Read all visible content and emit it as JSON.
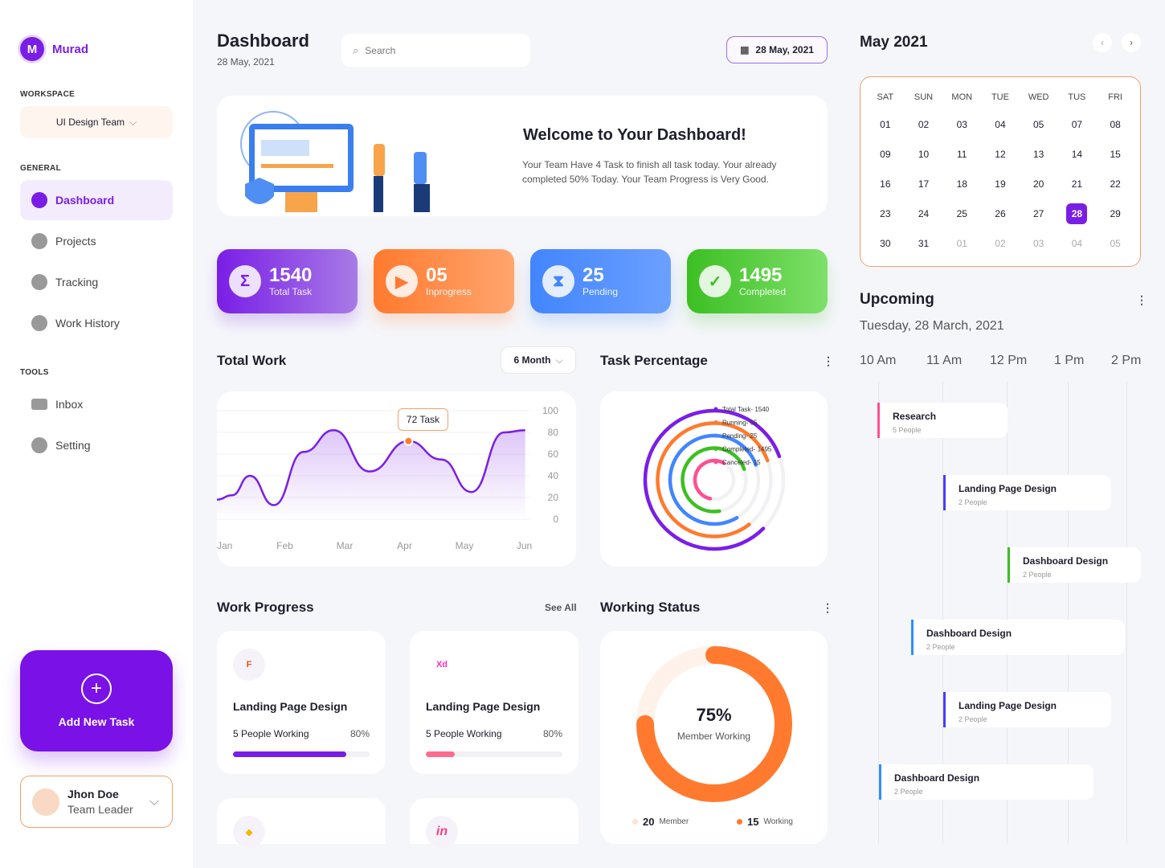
{
  "sidebar": {
    "brand": "Murad",
    "brand_initial": "M",
    "workspace_label": "WORKSPACE",
    "workspace_value": "UI Design Team",
    "general_label": "GENERAL",
    "tools_label": "TOOLS",
    "general_items": [
      {
        "label": "Dashboard",
        "icon": "dashboard-icon",
        "active": true
      },
      {
        "label": "Projects",
        "icon": "briefcase-icon"
      },
      {
        "label": "Tracking",
        "icon": "tracking-icon"
      },
      {
        "label": "Work History",
        "icon": "history-icon"
      }
    ],
    "tools_items": [
      {
        "label": "Inbox",
        "icon": "mail-icon"
      },
      {
        "label": "Setting",
        "icon": "gear-icon"
      }
    ],
    "add_task": "Add New Task",
    "user_name": "Jhon Doe",
    "user_role": "Team Leader"
  },
  "header": {
    "title": "Dashboard",
    "date": "28 May, 2021",
    "search_placeholder": "Search",
    "date_button": "28 May, 2021"
  },
  "welcome": {
    "title": "Welcome to Your Dashboard!",
    "text": "Your Team Have 4 Task to finish all task today. Your already completed 50% Today. Your Team Progress is Very Good."
  },
  "stats": [
    {
      "value": "1540",
      "label": "Total Task",
      "color": "#7a1ee6"
    },
    {
      "value": "05",
      "label": "Inprogress",
      "color": "#ff7a2e"
    },
    {
      "value": "25",
      "label": "Pending",
      "color": "#4285ff"
    },
    {
      "value": "1495",
      "label": "Completed",
      "color": "#3cbf23"
    }
  ],
  "total_work": {
    "title": "Total Work",
    "filter": "6 Month",
    "tooltip": "72 Task"
  },
  "chart_data": [
    {
      "type": "area",
      "xlabel": "",
      "ylabel": "",
      "categories": [
        "Jan",
        "Feb",
        "Mar",
        "Apr",
        "May",
        "Jun"
      ],
      "yticks": [
        100,
        80,
        60,
        40,
        20,
        0
      ],
      "ylim": [
        0,
        100
      ],
      "grid": true,
      "x": [
        0,
        0.25,
        0.55,
        0.95,
        1.45,
        1.95,
        2.55,
        3.2,
        3.75,
        4.25,
        4.8,
        5.15
      ],
      "y": [
        18,
        22,
        40,
        13,
        62,
        82,
        44,
        72,
        55,
        25,
        80,
        82
      ],
      "highlight": {
        "x": 3.2,
        "y": 72,
        "label": "72 Task"
      }
    },
    {
      "type": "radial-bar",
      "title": "Task Percentage",
      "series": [
        {
          "name": "Total Task- 1540",
          "value": 1540,
          "fraction": 0.82,
          "color": "#7a1ee6"
        },
        {
          "name": "Running- 05",
          "value": 5,
          "fraction": 0.8,
          "color": "#ff7a2e"
        },
        {
          "name": "Pending- 25",
          "value": 25,
          "fraction": 0.78,
          "color": "#4285ff"
        },
        {
          "name": "Completed- 1495",
          "value": 1495,
          "fraction": 0.72,
          "color": "#3cbf23"
        },
        {
          "name": "Canceled- 15",
          "value": 15,
          "fraction": 0.55,
          "color": "#ff4f93"
        }
      ]
    },
    {
      "type": "donut",
      "title": "Working Status",
      "percent": 75,
      "center_value": "75%",
      "center_label": "Member Working",
      "legend": [
        {
          "value": "20",
          "label": "Member"
        },
        {
          "value": "15",
          "label": "Working"
        }
      ]
    }
  ],
  "task_percentage": {
    "title": "Task Percentage"
  },
  "work_progress": {
    "title": "Work Progress",
    "see_all": "See All",
    "items": [
      {
        "title": "Landing Page Design",
        "people": "5 People Working",
        "percent": "80%",
        "progress": 0.83,
        "color": "#7a1ee6",
        "icon": "figma-icon",
        "glyph": "F"
      },
      {
        "title": "Landing Page Design",
        "people": "5 People Working",
        "percent": "80%",
        "progress": 0.21,
        "color": "#ff6b8e",
        "icon": "xd-icon",
        "glyph": "Xd"
      }
    ],
    "more": [
      {
        "icon": "sketch-icon",
        "glyph": "◆"
      },
      {
        "icon": "invision-icon",
        "glyph": "in"
      }
    ]
  },
  "working_status": {
    "title": "Working Status",
    "value": "75%",
    "label": "Member Working",
    "legend": [
      {
        "value": "20",
        "label": "Member"
      },
      {
        "value": "15",
        "label": "Working"
      }
    ]
  },
  "calendar": {
    "title": "May 2021",
    "days": [
      "SAT",
      "SUN",
      "MON",
      "TUE",
      "WED",
      "TUS",
      "FRI"
    ],
    "weeks": [
      [
        "01",
        "02",
        "03",
        "04",
        "05",
        "07",
        "08"
      ],
      [
        "09",
        "10",
        "11",
        "12",
        "13",
        "14",
        "15"
      ],
      [
        "16",
        "17",
        "18",
        "19",
        "20",
        "21",
        "22"
      ],
      [
        "23",
        "24",
        "25",
        "26",
        "27",
        "28",
        "29"
      ],
      [
        "30",
        "31",
        "01",
        "02",
        "03",
        "04",
        "05"
      ]
    ],
    "selected": "28"
  },
  "upcoming": {
    "title": "Upcoming",
    "date": "Tuesday, 28 March, 2021",
    "times": [
      "10 Am",
      "11 Am",
      "12 Pm",
      "1 Pm",
      "2 Pm"
    ],
    "events": [
      {
        "title": "Research",
        "people": "5 People",
        "color": "#ff4f93"
      },
      {
        "title": "Landing Page Design",
        "people": "2 People",
        "color": "#4a3bff"
      },
      {
        "title": "Dashboard Design",
        "people": "2 People",
        "color": "#3cbf23"
      },
      {
        "title": "Dashboard Design",
        "people": "2 People",
        "color": "#2f8fff"
      },
      {
        "title": "Landing Page Design",
        "people": "2 People",
        "color": "#4a3bff"
      },
      {
        "title": "Dashboard Design",
        "people": "2 People",
        "color": "#2f8fff"
      }
    ]
  }
}
